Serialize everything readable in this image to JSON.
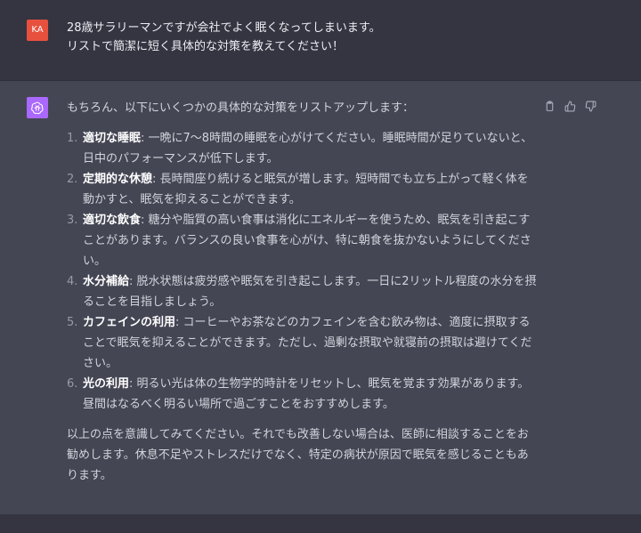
{
  "user_message": {
    "avatar_initials": "KA",
    "lines": [
      "28歳サラリーマンですが会社でよく眠くなってしまいます。",
      "リストで簡潔に短く具体的な対策を教えてください！"
    ]
  },
  "assistant_message": {
    "intro": "もちろん、以下にいくつかの具体的な対策をリストアップします：",
    "items": [
      {
        "num": "1.",
        "title": "適切な睡眠",
        "text": ": 一晩に7〜8時間の睡眠を心がけてください。睡眠時間が足りていないと、日中のパフォーマンスが低下します。"
      },
      {
        "num": "2.",
        "title": "定期的な休憩",
        "text": ": 長時間座り続けると眠気が増します。短時間でも立ち上がって軽く体を動かすと、眠気を抑えることができます。"
      },
      {
        "num": "3.",
        "title": "適切な飲食",
        "text": ": 糖分や脂質の高い食事は消化にエネルギーを使うため、眠気を引き起こすことがあります。バランスの良い食事を心がけ、特に朝食を抜かないようにしてください。"
      },
      {
        "num": "4.",
        "title": "水分補給",
        "text": ": 脱水状態は疲労感や眠気を引き起こします。一日に2リットル程度の水分を摂ることを目指しましょう。"
      },
      {
        "num": "5.",
        "title": "カフェインの利用",
        "text": ": コーヒーやお茶などのカフェインを含む飲み物は、適度に摂取することで眠気を抑えることができます。ただし、過剰な摂取や就寝前の摂取は避けてください。"
      },
      {
        "num": "6.",
        "title": "光の利用",
        "text": ": 明るい光は体の生物学的時計をリセットし、眠気を覚ます効果があります。昼間はなるべく明るい場所で過ごすことをおすすめします。"
      }
    ],
    "outro": "以上の点を意識してみてください。それでも改善しない場合は、医師に相談することをお勧めします。休息不足やストレスだけでなく、特定の病状が原因で眠気を感じることもあります。",
    "action_icons": [
      "clipboard-icon",
      "thumbs-up-icon",
      "thumbs-down-icon"
    ]
  },
  "colors": {
    "user_bg": "#343541",
    "assistant_bg": "#444654",
    "user_avatar": "#e8503e",
    "bot_avatar": "#ab68ff"
  }
}
